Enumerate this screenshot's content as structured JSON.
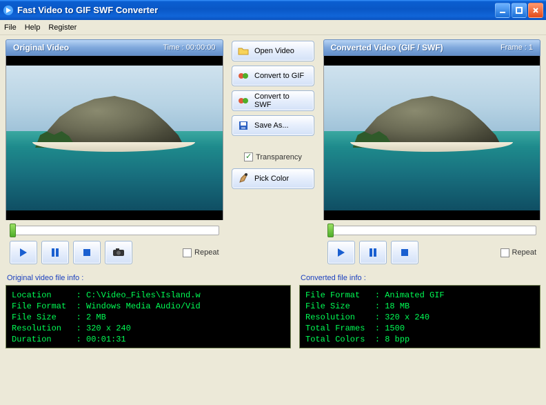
{
  "window": {
    "title": "Fast Video to GIF SWF Converter"
  },
  "menu": {
    "file": "File",
    "help": "Help",
    "register": "Register"
  },
  "left": {
    "header": "Original Video",
    "time_label": "Time : 00:00:00",
    "repeat_label": "Repeat"
  },
  "right": {
    "header": "Converted Video (GIF / SWF)",
    "frame_label": "Frame : 1",
    "repeat_label": "Repeat"
  },
  "center": {
    "open_video": "Open Video",
    "convert_gif": "Convert to GIF",
    "convert_swf": "Convert to SWF",
    "save_as": "Save As...",
    "transparency": "Transparency",
    "pick_color": "Pick Color"
  },
  "info": {
    "left_label": "Original video file info :",
    "right_label": "Converted file info :",
    "left_text": "Location     : C:\\Video_Files\\Island.w\nFile Format  : Windows Media Audio/Vid\nFile Size    : 2 MB\nResolution   : 320 x 240\nDuration     : 00:01:31",
    "right_text": "File Format   : Animated GIF\nFile Size     : 18 MB\nResolution    : 320 x 240\nTotal Frames  : 1500\nTotal Colors  : 8 bpp"
  }
}
